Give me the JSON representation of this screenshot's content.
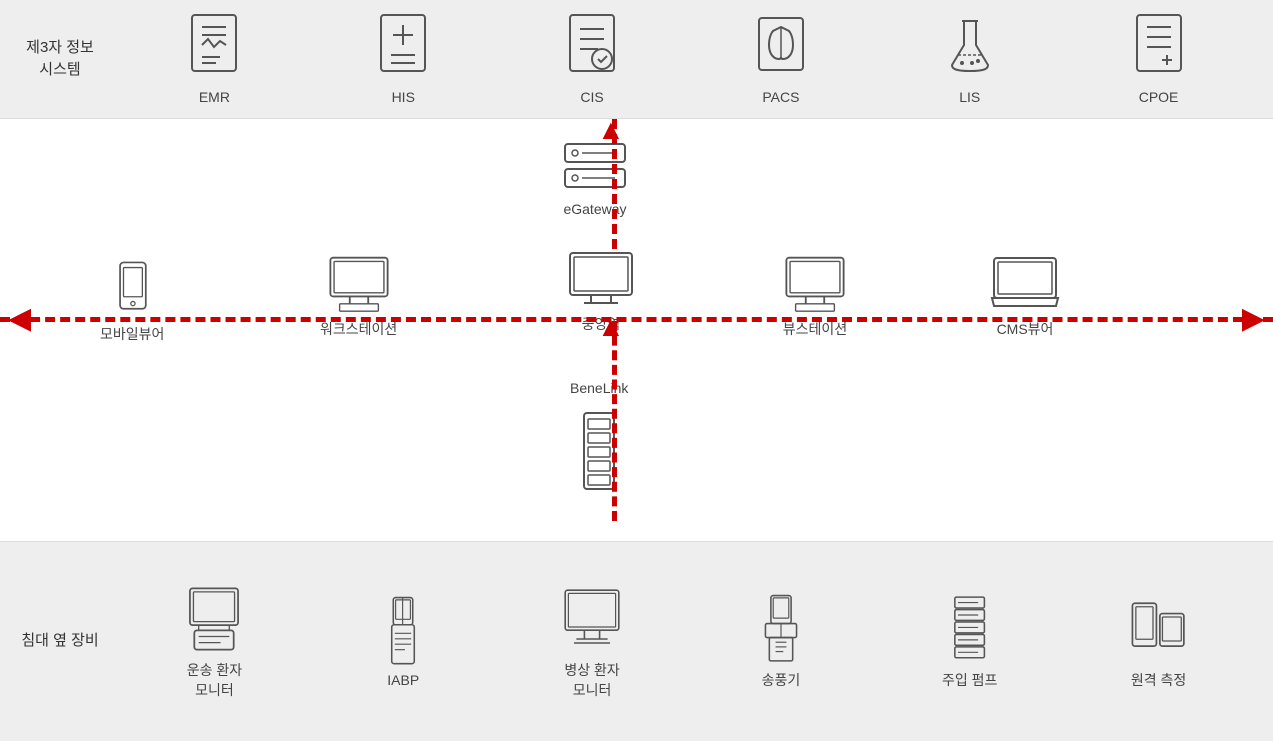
{
  "top": {
    "section_label": "제3자 정보\n시스템",
    "systems": [
      {
        "id": "emr",
        "label": "EMR"
      },
      {
        "id": "his",
        "label": "HIS"
      },
      {
        "id": "cis",
        "label": "CIS"
      },
      {
        "id": "pacs",
        "label": "PACS"
      },
      {
        "id": "lis",
        "label": "LIS"
      },
      {
        "id": "cpoe",
        "label": "CPOE"
      }
    ]
  },
  "middle": {
    "egateway_label": "eGateway",
    "central_label": "중앙역",
    "mobile_label": "모바일뷰어",
    "workstation_label": "워크스테이션",
    "viewstation_label": "뷰스테이션",
    "cms_label": "CMS뷰어",
    "benelink_label": "BeneLink"
  },
  "bottom": {
    "section_label": "침대 옆 장비",
    "devices": [
      {
        "id": "transport",
        "label": "운송 환자\n모니터"
      },
      {
        "id": "iabp",
        "label": "IABP"
      },
      {
        "id": "bedside",
        "label": "병상 환자\n모니터"
      },
      {
        "id": "ventilator",
        "label": "송풍기"
      },
      {
        "id": "infusion",
        "label": "주입 펌프"
      },
      {
        "id": "remote",
        "label": "원격 측정"
      }
    ]
  }
}
